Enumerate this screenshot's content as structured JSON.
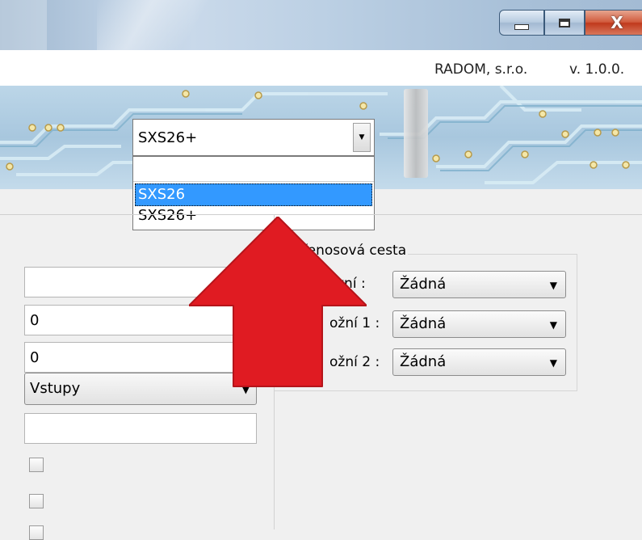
{
  "window": {
    "minimize_glyph": "",
    "close_glyph": "X"
  },
  "info": {
    "company": "RADOM, s.r.o.",
    "version": "v. 1.0.0."
  },
  "device_combo": {
    "value": "SXS26+",
    "options": [
      "SXS26",
      "SXS26+"
    ],
    "highlighted": "SXS26"
  },
  "form": {
    "field1": "",
    "field2": "0",
    "field3": "0",
    "select": "Vstupy",
    "field5": ""
  },
  "group": {
    "title": "řenosová cesta",
    "rows": [
      {
        "label": "yní :",
        "value": "Žádná"
      },
      {
        "label": "ožní 1 :",
        "value": "Žádná"
      },
      {
        "label": "ožní 2 :",
        "value": "Žádná"
      }
    ]
  },
  "colors": {
    "accent_selection": "#3399ff",
    "annotation_arrow": "#e01b22"
  }
}
